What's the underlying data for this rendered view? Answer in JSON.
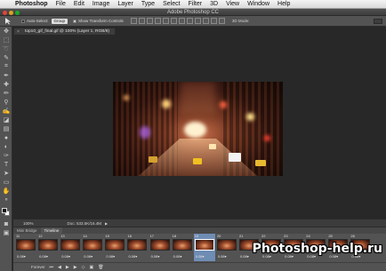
{
  "menubar": {
    "items": [
      "Photoshop",
      "File",
      "Edit",
      "Image",
      "Layer",
      "Type",
      "Select",
      "Filter",
      "3D",
      "View",
      "Window",
      "Help"
    ]
  },
  "window": {
    "title": "Adobe Photoshop CC"
  },
  "options": {
    "auto_select_label": "Auto-Select:",
    "auto_select_value": "Group",
    "transform_label": "Show Transform Controls",
    "mode3d_label": "3D Mode:"
  },
  "document": {
    "tab_label": "top10_gif_final.gif @ 100% (Layer 1, RGB/8)"
  },
  "status": {
    "zoom": "100%",
    "doc_size": "Doc: 533.5K/16.4M"
  },
  "panels": {
    "tabs": [
      "Mini Bridge",
      "Timeline"
    ]
  },
  "timeline": {
    "frame_numbers": [
      "11",
      "12",
      "13",
      "14",
      "15",
      "16",
      "17",
      "18",
      "19",
      "20",
      "21",
      "22",
      "23",
      "24",
      "25",
      "26"
    ],
    "delays": [
      "0.08▾",
      "0.08▾",
      "0.08▾",
      "0.08▾",
      "0.08▾",
      "0.08▾",
      "0.08▾",
      "0.08▾",
      "0.08▾",
      "0.08▾",
      "0.08▾",
      "0.08▾",
      "0.08▾",
      "0.08▾",
      "0.08▾",
      "0.08▾"
    ],
    "selected_frame": 8,
    "loop_label": "Forever"
  },
  "watermark": "Photoshop-help.ru",
  "colors": {
    "workspace": "#282828",
    "panel": "#535353",
    "selection": "#6f8cb3"
  }
}
